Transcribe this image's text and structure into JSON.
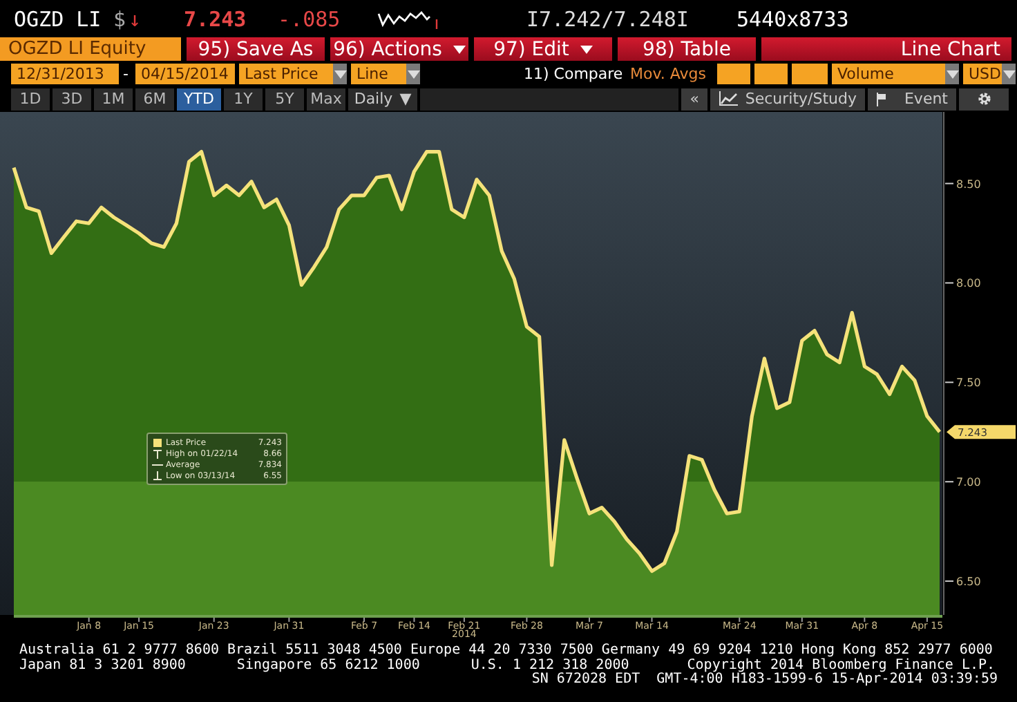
{
  "quote": {
    "ticker": "OGZD LI",
    "currency": "$",
    "direction": "↓",
    "price": "7.243",
    "change": "-.085",
    "bid_ask": "I7.242/7.248I",
    "size": "5440x8733"
  },
  "toolbar": {
    "security": "OGZD LI Equity",
    "buttons": [
      {
        "label": "95) Save As",
        "has_menu": false
      },
      {
        "label": "96) Actions",
        "has_menu": true
      },
      {
        "label": "97) Edit",
        "has_menu": true
      },
      {
        "label": "98) Table",
        "has_menu": false
      }
    ],
    "title": "Line Chart"
  },
  "settings": {
    "start_date": "12/31/2013",
    "separator": "-",
    "end_date": "04/15/2014",
    "field": "Last Price",
    "style": "Line",
    "compare": "11) Compare",
    "mov_avgs_label": "Mov. Avgs",
    "volume": "Volume",
    "currency": "USD"
  },
  "periods": [
    {
      "label": "1D",
      "selected": false
    },
    {
      "label": "3D",
      "selected": false
    },
    {
      "label": "1M",
      "selected": false
    },
    {
      "label": "6M",
      "selected": false
    },
    {
      "label": "YTD",
      "selected": true
    },
    {
      "label": "1Y",
      "selected": false
    },
    {
      "label": "5Y",
      "selected": false
    },
    {
      "label": "Max",
      "selected": false
    }
  ],
  "frequency": {
    "label": "Daily",
    "caret": "▼"
  },
  "tools": {
    "collapse": "«",
    "study": "Security/Study",
    "event": "Event"
  },
  "chart": {
    "price_tag": "7.243",
    "year_label": "2014",
    "legend": [
      {
        "kind": "last",
        "label": "Last Price",
        "value": "7.243"
      },
      {
        "kind": "high",
        "label": "High on 01/22/14",
        "value": "8.66"
      },
      {
        "kind": "average",
        "label": "Average",
        "value": "7.834"
      },
      {
        "kind": "low",
        "label": "Low on 03/13/14",
        "value": "6.55"
      }
    ],
    "chart_data": {
      "type": "area",
      "ylim": [
        6.33,
        8.86
      ],
      "categories": [
        null,
        null,
        null,
        null,
        null,
        null,
        "Jan 8",
        null,
        null,
        null,
        "Jan 15",
        null,
        null,
        null,
        null,
        null,
        "Jan 23",
        null,
        null,
        null,
        null,
        null,
        "Jan 31",
        null,
        null,
        null,
        null,
        null,
        "Feb 7",
        null,
        null,
        null,
        "Feb 14",
        null,
        null,
        null,
        "Feb 21",
        null,
        null,
        null,
        null,
        "Feb 28",
        null,
        null,
        null,
        null,
        "Mar 7",
        null,
        null,
        null,
        null,
        "Mar 14",
        null,
        null,
        null,
        null,
        null,
        null,
        "Mar 24",
        null,
        null,
        null,
        null,
        "Mar 31",
        null,
        null,
        null,
        null,
        "Apr 8",
        null,
        null,
        null,
        null,
        "Apr 15",
        null
      ],
      "yticks": [
        {
          "value": 6.5,
          "label": "6.50"
        },
        {
          "value": 7,
          "label": "7.00"
        },
        {
          "value": 7.5,
          "label": "7.50"
        },
        {
          "value": 8,
          "label": "8.00"
        },
        {
          "value": 8.5,
          "label": "8.50"
        }
      ],
      "series": [
        {
          "color": "#f5e27a",
          "values": [
            8.58,
            8.38,
            8.36,
            8.15,
            8.23,
            8.31,
            8.3,
            8.38,
            8.33,
            8.29,
            8.25,
            8.2,
            8.18,
            8.3,
            8.61,
            8.66,
            8.44,
            8.49,
            8.44,
            8.51,
            8.38,
            8.42,
            8.29,
            7.99,
            8.08,
            8.18,
            8.37,
            8.44,
            8.44,
            8.53,
            8.54,
            8.37,
            8.56,
            8.66,
            8.66,
            8.37,
            8.33,
            8.52,
            8.44,
            8.16,
            8.02,
            7.78,
            7.73,
            6.58,
            7.21,
            7.02,
            6.84,
            6.87,
            6.8,
            6.71,
            6.64,
            6.55,
            6.59,
            6.75,
            7.13,
            7.11,
            6.96,
            6.84,
            6.85,
            7.33,
            7.62,
            7.37,
            7.4,
            7.71,
            7.76,
            7.64,
            7.6,
            7.85,
            7.58,
            7.54,
            7.44,
            7.58,
            7.51,
            7.33,
            7.25
          ]
        }
      ]
    }
  },
  "footer": {
    "line_1": "Australia 61 2 9777 8600 Brazil 5511 3048 4500 Europe 44 20 7330 7500 Germany 49 69 9204 1210 Hong Kong 852 2977 6000",
    "line_2": [
      "Japan 81 3 3201 8900",
      "Singapore 65 6212 1000",
      "U.S. 1 212 318 2000",
      "Copyright 2014 Bloomberg Finance L.P."
    ],
    "line_3": "SN 672028 EDT  GMT-4:00 H183-1599-6 15-Apr-2014 03:39:59"
  }
}
